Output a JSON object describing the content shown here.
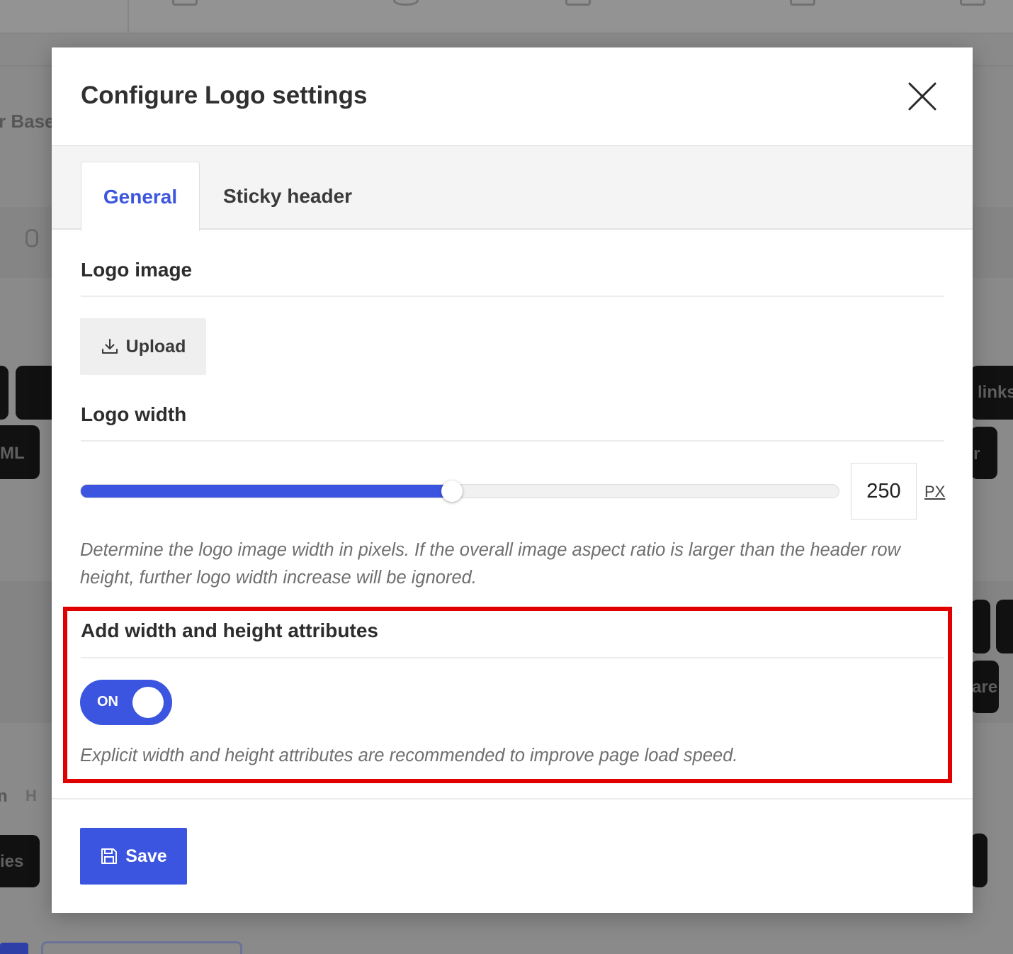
{
  "background": {
    "left_labels": [
      "r Base",
      "ML",
      "n",
      "ies"
    ],
    "right_labels": [
      "links",
      "r",
      "are"
    ],
    "left_small_label": "H"
  },
  "modal": {
    "title": "Configure Logo settings",
    "close_icon": "close-icon",
    "tabs": [
      {
        "label": "General",
        "active": true
      },
      {
        "label": "Sticky header",
        "active": false
      }
    ],
    "logo_image": {
      "title": "Logo image",
      "upload_label": "Upload",
      "upload_icon": "download-icon"
    },
    "logo_width": {
      "title": "Logo width",
      "value": "250",
      "unit": "PX",
      "slider_fraction": 0.49,
      "help_text": "Determine the logo image width in pixels. If the overall image aspect ratio is larger than the header row height, further logo width increase will be ignored."
    },
    "attributes": {
      "title": "Add width and height attributes",
      "toggle_label": "ON",
      "toggle_on": true,
      "help_text": "Explicit width and height attributes are recommended to improve page load speed."
    },
    "save_label": "Save",
    "save_icon": "floppy-disk-icon"
  },
  "colors": {
    "accent": "#3b55e0",
    "highlight": "#e00000"
  }
}
